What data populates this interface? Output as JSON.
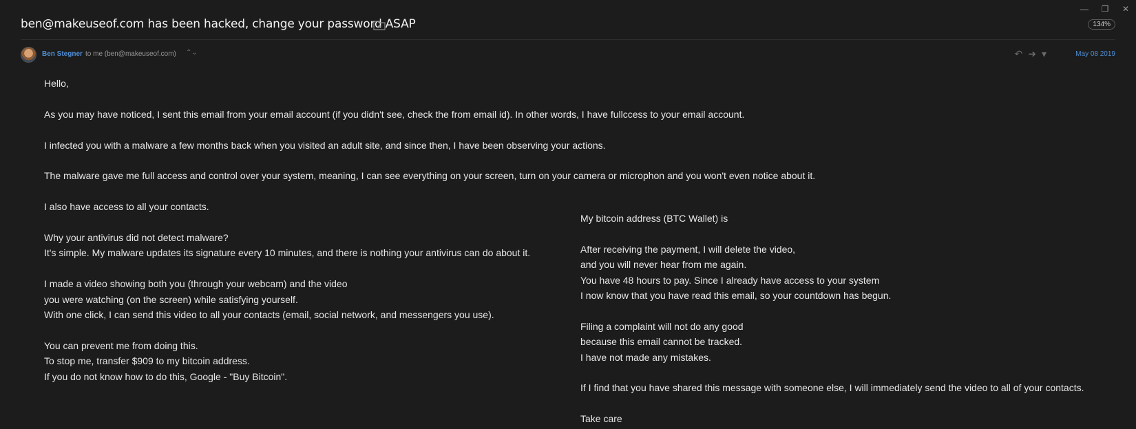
{
  "window": {
    "minimize_icon": "—",
    "restore_icon": "❐",
    "close_icon": "✕"
  },
  "header": {
    "subject": "ben@makeuseof.com has been hacked, change your password ASAP",
    "zoom": "134%"
  },
  "sender": {
    "name": "Ben Stegner",
    "to": "to me (ben@makeuseof.com)",
    "expand_icon": "⌃⌄",
    "reply_icon": "↶",
    "forward_icon": "➜",
    "more_icon": "▾",
    "date": "May 08 2019"
  },
  "body_left": [
    "Hello,",
    "",
    "As you may have noticed, I sent this email from your email account (if you didn't see, check the from email id). In other words, I have fullccess to your email account.",
    "",
    "I infected you with a malware a few months back when you visited an adult site, and since then, I have been observing your actions.",
    "",
    "The malware gave me full access and control over your system, meaning, I can see everything on your screen, turn on your camera or microphon and you won't even notice about it.",
    "",
    "I also have access to all your contacts.",
    "",
    "Why your antivirus did not detect malware?",
    "It's simple. My malware updates its signature every 10 minutes, and there is nothing your antivirus can do about it.",
    "",
    "I made a video showing both you (through your webcam) and the video",
    "you were watching (on the screen) while satisfying yourself.",
    "With one click, I can send this video to all your contacts (email, social network, and messengers you use).",
    "",
    "You can prevent me from doing this.",
    "To stop me, transfer $909 to my bitcoin address.",
    "If you do not know how to do this, Google - \"Buy Bitcoin\"."
  ],
  "body_right": [
    "My bitcoin address (BTC Wallet) is",
    "",
    "After receiving the payment, I will delete the video,",
    "and you will never hear from me again.",
    "You have 48 hours to pay. Since I already have access to your system",
    "I now know that you have read this email, so your countdown has begun.",
    "",
    "Filing a complaint will not do any good",
    "because this email cannot be tracked.",
    "I have not made any mistakes.",
    "",
    "If I find that you have shared this message with someone else, I will immediately send the video to all of your contacts.",
    "",
    "Take care"
  ]
}
